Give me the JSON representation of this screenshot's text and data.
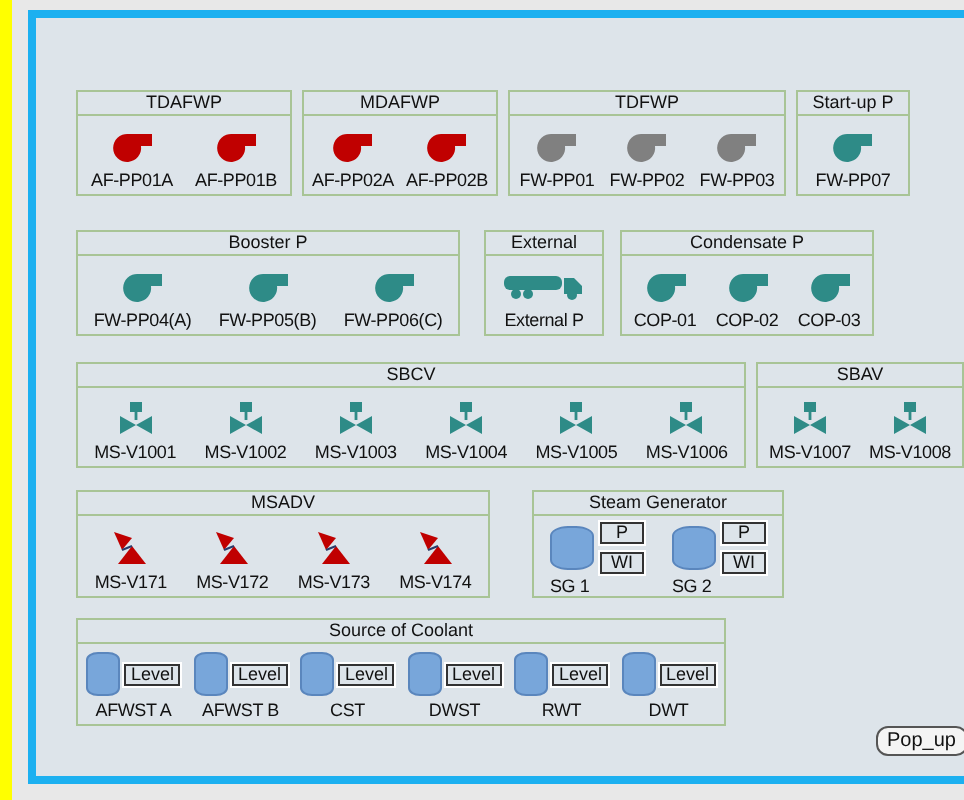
{
  "rows": [
    {
      "groups": [
        {
          "title": "TDAFWP",
          "items": [
            {
              "kind": "pump",
              "label": "AF-PP01A",
              "color": "#c00000"
            },
            {
              "kind": "pump",
              "label": "AF-PP01B",
              "color": "#c00000"
            }
          ]
        },
        {
          "title": "MDAFWP",
          "items": [
            {
              "kind": "pump",
              "label": "AF-PP02A",
              "color": "#c00000"
            },
            {
              "kind": "pump",
              "label": "AF-PP02B",
              "color": "#c00000"
            }
          ]
        },
        {
          "title": "TDFWP",
          "items": [
            {
              "kind": "pump",
              "label": "FW-PP01",
              "color": "#808080"
            },
            {
              "kind": "pump",
              "label": "FW-PP02",
              "color": "#808080"
            },
            {
              "kind": "pump",
              "label": "FW-PP03",
              "color": "#808080"
            }
          ]
        },
        {
          "title": "Start-up P",
          "items": [
            {
              "kind": "pump",
              "label": "FW-PP07",
              "color": "#2e8b87"
            }
          ]
        }
      ]
    },
    {
      "groups": [
        {
          "title": "Booster P",
          "items": [
            {
              "kind": "pump",
              "label": "FW-PP04(A)",
              "color": "#2e8b87"
            },
            {
              "kind": "pump",
              "label": "FW-PP05(B)",
              "color": "#2e8b87"
            },
            {
              "kind": "pump",
              "label": "FW-PP06(C)",
              "color": "#2e8b87"
            }
          ]
        },
        {
          "title": "External",
          "items": [
            {
              "kind": "truck",
              "label": "External P",
              "color": "#2e8b87"
            }
          ]
        },
        {
          "title": "Condensate P",
          "items": [
            {
              "kind": "pump",
              "label": "COP-01",
              "color": "#2e8b87"
            },
            {
              "kind": "pump",
              "label": "COP-02",
              "color": "#2e8b87"
            },
            {
              "kind": "pump",
              "label": "COP-03",
              "color": "#2e8b87"
            }
          ]
        }
      ]
    },
    {
      "groups": [
        {
          "title": "SBCV",
          "items": [
            {
              "kind": "valve",
              "label": "MS-V1001",
              "color": "#2e8b87"
            },
            {
              "kind": "valve",
              "label": "MS-V1002",
              "color": "#2e8b87"
            },
            {
              "kind": "valve",
              "label": "MS-V1003",
              "color": "#2e8b87"
            },
            {
              "kind": "valve",
              "label": "MS-V1004",
              "color": "#2e8b87"
            },
            {
              "kind": "valve",
              "label": "MS-V1005",
              "color": "#2e8b87"
            },
            {
              "kind": "valve",
              "label": "MS-V1006",
              "color": "#2e8b87"
            }
          ]
        },
        {
          "title": "SBAV",
          "items": [
            {
              "kind": "valve",
              "label": "MS-V1007",
              "color": "#2e8b87"
            },
            {
              "kind": "valve",
              "label": "MS-V1008",
              "color": "#2e8b87"
            }
          ]
        }
      ]
    },
    {
      "groups": [
        {
          "title": "MSADV",
          "items": [
            {
              "kind": "relief",
              "label": "MS-V171",
              "color": "#c00000"
            },
            {
              "kind": "relief",
              "label": "MS-V172",
              "color": "#c00000"
            },
            {
              "kind": "relief",
              "label": "MS-V173",
              "color": "#c00000"
            },
            {
              "kind": "relief",
              "label": "MS-V174",
              "color": "#c00000"
            }
          ]
        },
        {
          "title": "Steam Generator",
          "items": [
            {
              "kind": "generator",
              "label": "SG 1",
              "indicators": [
                "P",
                "WI"
              ]
            },
            {
              "kind": "generator",
              "label": "SG 2",
              "indicators": [
                "P",
                "WI"
              ]
            }
          ]
        }
      ]
    },
    {
      "groups": [
        {
          "title": "Source of Coolant",
          "items": [
            {
              "kind": "tank",
              "label": "AFWST A",
              "indicators": [
                "Level"
              ]
            },
            {
              "kind": "tank",
              "label": "AFWST B",
              "indicators": [
                "Level"
              ]
            },
            {
              "kind": "tank",
              "label": "CST",
              "indicators": [
                "Level"
              ]
            },
            {
              "kind": "tank",
              "label": "DWST",
              "indicators": [
                "Level"
              ]
            },
            {
              "kind": "tank",
              "label": "RWT",
              "indicators": [
                "Level"
              ]
            },
            {
              "kind": "tank",
              "label": "DWT",
              "indicators": [
                "Level"
              ]
            }
          ]
        }
      ]
    }
  ],
  "popup_button": "Pop_up"
}
